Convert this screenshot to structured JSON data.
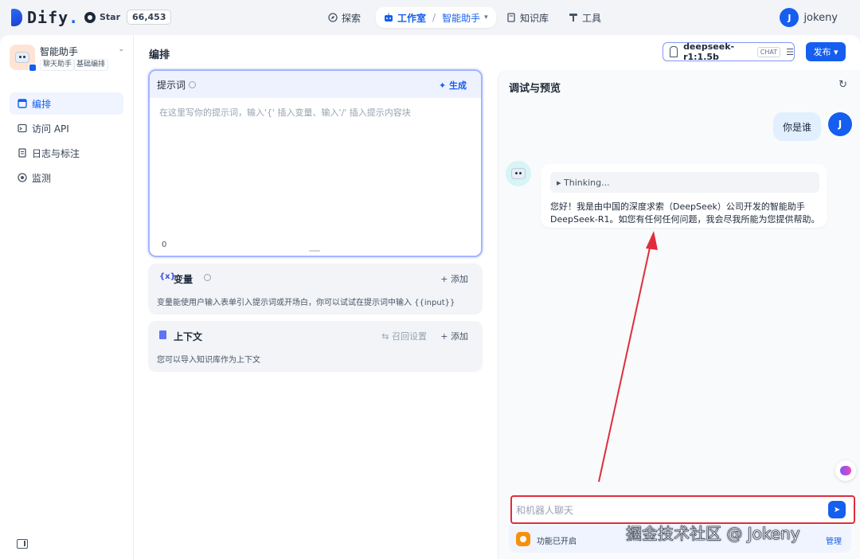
{
  "brand": {
    "name": "Dify",
    "dot": "."
  },
  "github": {
    "label": "Star",
    "count": "66,453"
  },
  "nav": {
    "explore": "探索",
    "studio": "工作室",
    "separator": "/",
    "current_app": "智能助手",
    "knowledge": "知识库",
    "tools": "工具"
  },
  "user": {
    "initial": "J",
    "name": "jokeny"
  },
  "sidebar": {
    "app_name": "智能助手",
    "tags": [
      "聊天助手",
      "基础编排"
    ],
    "items": [
      {
        "label": "编排",
        "icon": "layout-icon"
      },
      {
        "label": "访问 API",
        "icon": "terminal-icon"
      },
      {
        "label": "日志与标注",
        "icon": "file-icon"
      },
      {
        "label": "监测",
        "icon": "monitor-icon"
      }
    ]
  },
  "editor": {
    "title": "编排",
    "model": {
      "name": "deepseek-r1:1.5b",
      "mode": "CHAT"
    },
    "publish_label": "发布",
    "prompt": {
      "label": "提示词",
      "generate_label": "生成",
      "placeholder": "在这里写你的提示词，输入'{' 插入变量、输入'/' 插入提示内容块",
      "count": "0"
    },
    "variables": {
      "icon_text": "{x}",
      "title": "变量",
      "add_label": "+ 添加",
      "description": "变量能使用户输入表单引入提示词或开场白，你可以试试在提示词中输入 {{input}}"
    },
    "context": {
      "title": "上下文",
      "recall_label": "召回设置",
      "add_label": "+ 添加",
      "description": "您可以导入知识库作为上下文"
    }
  },
  "debug": {
    "title": "调试与预览",
    "user_message": "你是谁",
    "user_initial": "J",
    "thinking_label": "▸ Thinking...",
    "bot_message": "您好！我是由中国的深度求索（DeepSeek）公司开发的智能助手DeepSeek-R1。如您有任何任何问题，我会尽我所能为您提供帮助。",
    "input_placeholder": "和机器人聊天",
    "features_label": "功能已开启",
    "features_manage": "管理"
  },
  "watermark": "掘金技术社区 @ Jokeny",
  "colors": {
    "accent": "#155eef",
    "annotation": "#e02d3c"
  }
}
